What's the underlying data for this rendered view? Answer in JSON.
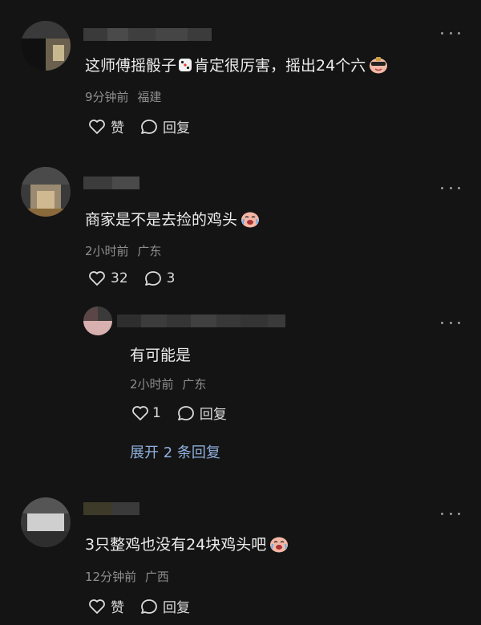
{
  "comments": [
    {
      "text": "这师傅摇骰子",
      "text2": "肯定很厉害，摇出24个六",
      "dice_icon": "dice-icon",
      "end_emoji": "cool-face-emoji",
      "time": "9分钟前",
      "location": "福建",
      "like_label": "赞",
      "reply_label": "回复"
    },
    {
      "text": "商家是不是去捡的鸡头",
      "end_emoji": "crying-laugh-emoji",
      "time": "2小时前",
      "location": "广东",
      "like_label": "32",
      "reply_label": "3"
    },
    {
      "text": "有可能是",
      "time": "2小时前",
      "location": "广东",
      "like_label": "1",
      "reply_label": "回复",
      "expand_label": "展开 2 条回复"
    },
    {
      "text": "3只整鸡也没有24块鸡头吧",
      "end_emoji": "crying-laugh-emoji",
      "time": "12分钟前",
      "location": "广西",
      "like_label": "赞",
      "reply_label": "回复"
    }
  ],
  "icons": {
    "like": "heart-outline-icon",
    "reply": "speech-bubble-icon",
    "more": "more-dots-icon"
  }
}
